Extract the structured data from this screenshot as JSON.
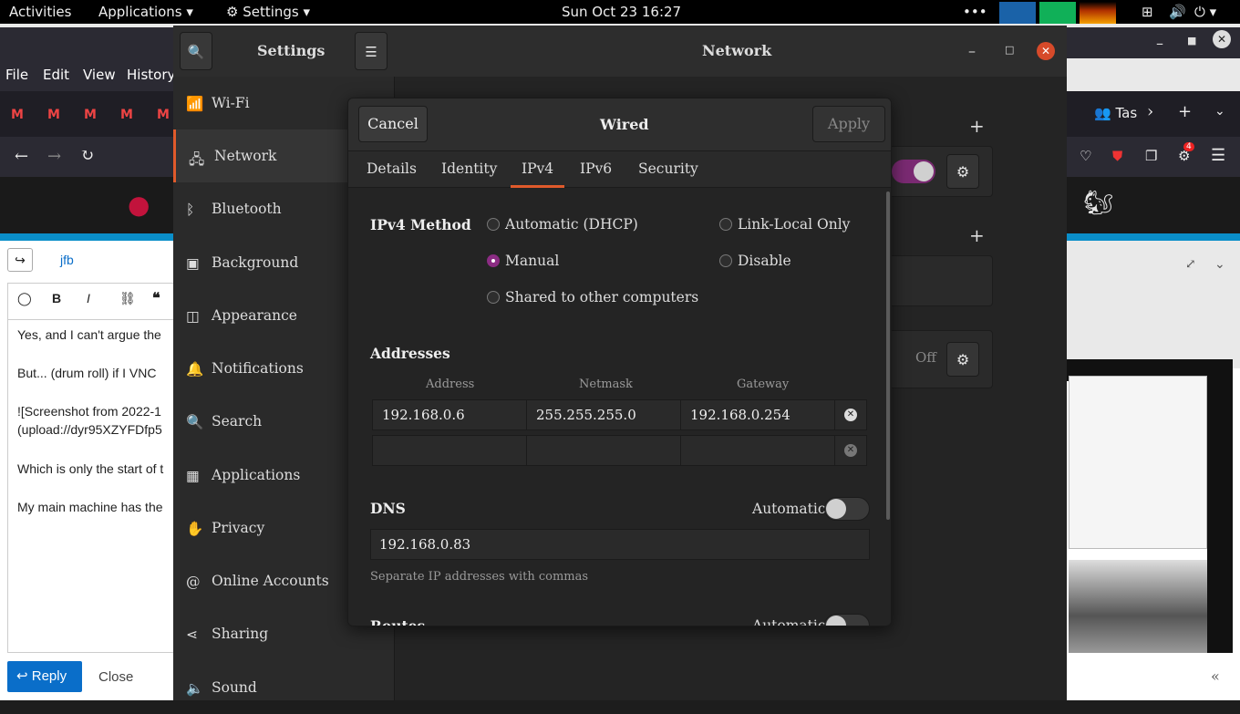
{
  "topbar": {
    "activities": "Activities",
    "applications": "Applications",
    "settings": "Settings",
    "clock": "Sun  Oct  23  16:27"
  },
  "browser": {
    "menu": [
      "File",
      "Edit",
      "View",
      "History"
    ],
    "tab_label": "Tas",
    "user": "jfb",
    "post_lines": [
      "Yes, and I can't argue the",
      "But...  (drum roll) if I VNC",
      "![Screenshot from 2022-1",
      "(upload://dyr95XZYFDfp5",
      "Which is only the start of t",
      "My main machine has the"
    ],
    "reply": "Reply",
    "close": "Close",
    "notif_count": "4"
  },
  "settings": {
    "title": "Settings",
    "panel_title": "Network",
    "sidebar": [
      {
        "label": "Wi-Fi",
        "icon": "wifi-icon"
      },
      {
        "label": "Network",
        "icon": "network-icon"
      },
      {
        "label": "Bluetooth",
        "icon": "bluetooth-icon"
      },
      {
        "label": "Background",
        "icon": "background-icon"
      },
      {
        "label": "Appearance",
        "icon": "appearance-icon"
      },
      {
        "label": "Notifications",
        "icon": "bell-icon"
      },
      {
        "label": "Search",
        "icon": "search-icon"
      },
      {
        "label": "Applications",
        "icon": "applications-icon"
      },
      {
        "label": "Privacy",
        "icon": "hand-icon"
      },
      {
        "label": "Online Accounts",
        "icon": "at-icon"
      },
      {
        "label": "Sharing",
        "icon": "share-icon"
      },
      {
        "label": "Sound",
        "icon": "speaker-icon"
      }
    ],
    "off_label": "Off"
  },
  "dialog": {
    "title": "Wired",
    "cancel": "Cancel",
    "apply": "Apply",
    "tabs": [
      "Details",
      "Identity",
      "IPv4",
      "IPv6",
      "Security"
    ],
    "selected_tab": "IPv4",
    "method_label": "IPv4 Method",
    "methods": {
      "automatic": "Automatic  (DHCP)",
      "link_local": "Link-Local  Only",
      "manual": "Manual",
      "disable": "Disable",
      "shared": "Shared  to  other  computers"
    },
    "selected_method": "Manual",
    "addresses_label": "Addresses",
    "columns": [
      "Address",
      "Netmask",
      "Gateway"
    ],
    "rows": [
      {
        "address": "192.168.0.6",
        "netmask": "255.255.255.0",
        "gateway": "192.168.0.254"
      },
      {
        "address": "",
        "netmask": "",
        "gateway": ""
      }
    ],
    "dns_label": "DNS",
    "dns_automatic_label": "Automatic",
    "dns_automatic": false,
    "dns_value": "192.168.0.83",
    "dns_hint": "Separate  IP  addresses  with  commas",
    "routes_label": "Routes",
    "routes_automatic_label": "Automatic"
  },
  "colors": {
    "accent": "#e05a2b",
    "radio": "#8b2c83",
    "toggle_on": "#7a2a72",
    "cyan": "#0a8ec9"
  }
}
